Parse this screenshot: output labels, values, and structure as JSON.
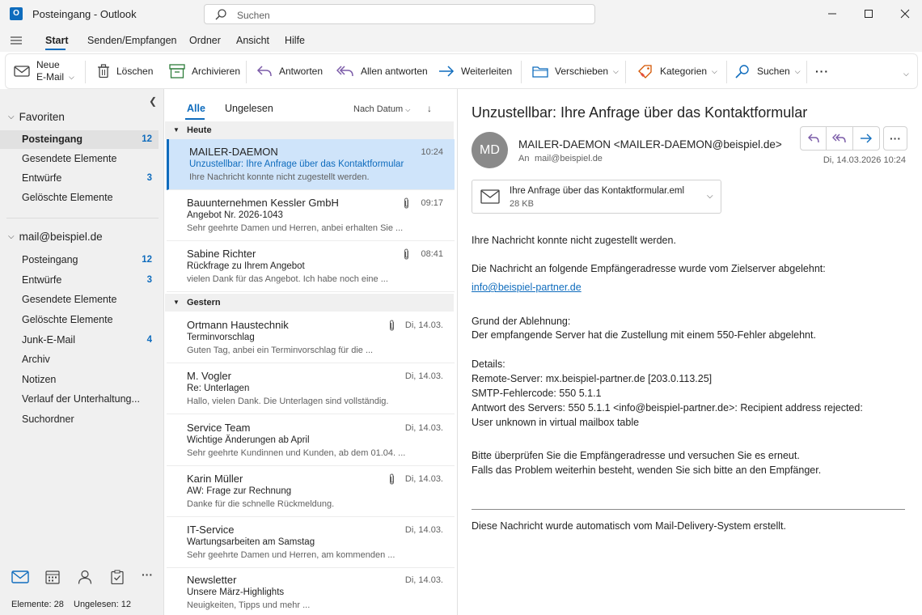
{
  "window": {
    "title": "Posteingang - Outlook",
    "search_placeholder": "Suchen",
    "app_letter": "O"
  },
  "menu": {
    "items": [
      "Start",
      "Senden/Empfangen",
      "Ordner",
      "Ansicht",
      "Hilfe"
    ],
    "active": "Start"
  },
  "ribbon": {
    "new_mail_line1": "Neue",
    "new_mail_line2": "E-Mail",
    "delete": "Löschen",
    "archive": "Archivieren",
    "reply": "Antworten",
    "reply_all": "Allen antworten",
    "forward": "Weiterleiten",
    "move": "Verschieben",
    "categorize": "Kategorien",
    "find": "Suchen",
    "more": "···"
  },
  "nav": {
    "favorites_label": "Favoriten",
    "favorites": [
      {
        "label": "Posteingang",
        "count": "12",
        "selected": true
      },
      {
        "label": "Gesendete Elemente",
        "count": ""
      },
      {
        "label": "Entwürfe",
        "count": "3"
      },
      {
        "label": "Gelöschte Elemente",
        "count": ""
      }
    ],
    "account_label": "mail@beispiel.de",
    "account": [
      {
        "label": "Posteingang",
        "count": "12"
      },
      {
        "label": "Entwürfe",
        "count": "3"
      },
      {
        "label": "Gesendete Elemente",
        "count": ""
      },
      {
        "label": "Gelöschte Elemente",
        "count": ""
      },
      {
        "label": "Junk-E-Mail",
        "count": "4"
      },
      {
        "label": "Archiv",
        "count": ""
      },
      {
        "label": "Notizen",
        "count": ""
      },
      {
        "label": "Verlauf der Unterhaltung...",
        "count": ""
      },
      {
        "label": "Suchordner",
        "count": ""
      }
    ]
  },
  "status": {
    "items": "Elemente: 28",
    "unread": "Ungelesen: 12"
  },
  "list": {
    "tab_all": "Alle",
    "tab_unread": "Ungelesen",
    "sort": "Nach Datum",
    "group_today": "Heute",
    "group_yesterday": "Gestern",
    "today": [
      {
        "sender": "MAILER-DAEMON",
        "subject": "Unzustellbar: Ihre Anfrage über das Kontaktformular",
        "preview": "Ihre Nachricht konnte nicht zugestellt werden.",
        "time": "10:24",
        "attachment": false,
        "selected": true
      },
      {
        "sender": "Bauunternehmen Kessler GmbH",
        "subject": "Angebot Nr. 2026-1043",
        "preview": "Sehr geehrte Damen und Herren, anbei erhalten Sie ...",
        "time": "09:17",
        "attachment": true
      },
      {
        "sender": "Sabine Richter",
        "subject": "Rückfrage zu Ihrem Angebot",
        "preview": "vielen Dank für das Angebot. Ich habe noch eine ...",
        "time": "08:41",
        "attachment": true
      }
    ],
    "yesterday": [
      {
        "sender": "Ortmann Haustechnik",
        "subject": "Terminvorschlag",
        "preview": "Guten Tag, anbei ein Terminvorschlag für die ...",
        "time": "Di, 14.03.",
        "attachment": true
      },
      {
        "sender": "M. Vogler",
        "subject": "Re: Unterlagen",
        "preview": "Hallo, vielen Dank. Die Unterlagen sind vollständig.",
        "time": "Di, 14.03.",
        "attachment": false
      },
      {
        "sender": "Service Team",
        "subject": "Wichtige Änderungen ab April",
        "preview": "Sehr geehrte Kundinnen und Kunden, ab dem 01.04. ...",
        "time": "Di, 14.03.",
        "attachment": false
      },
      {
        "sender": "Karin Müller",
        "subject": "AW: Frage zur Rechnung",
        "preview": "Danke für die schnelle Rückmeldung.",
        "time": "Di, 14.03.",
        "attachment": true
      },
      {
        "sender": "IT-Service",
        "subject": "Wartungsarbeiten am Samstag",
        "preview": "Sehr geehrte Damen und Herren, am kommenden ...",
        "time": "Di, 14.03.",
        "attachment": false
      },
      {
        "sender": "Newsletter",
        "subject": "Unsere März-Highlights",
        "preview": "Neuigkeiten, Tipps und mehr ...",
        "time": "Di, 14.03.",
        "attachment": false
      }
    ]
  },
  "reader": {
    "subject": "Unzustellbar: Ihre Anfrage über das Kontaktformular",
    "avatar_initials": "MD",
    "from": "MAILER-DAEMON <MAILER-DAEMON@beispiel.de>",
    "to_label": "An",
    "to": "mail@beispiel.de",
    "date": "Di, 14.03.2026 10:24",
    "attachment_name": "Ihre Anfrage über das Kontaktformular.eml",
    "attachment_size": "28 KB",
    "body": {
      "p1": "Ihre Nachricht konnte nicht zugestellt werden.",
      "p2": "Die Nachricht an folgende Empfängeradresse wurde vom Zielserver abgelehnt:",
      "link": "info@beispiel-partner.de",
      "reason_head": "Grund der Ablehnung:",
      "reason": "Der empfangende Server hat die Zustellung mit einem 550-Fehler abgelehnt.",
      "details_head": "Details:",
      "d1": "Remote-Server: mx.beispiel-partner.de [203.0.113.25]",
      "d2": "SMTP-Fehlercode: 550 5.1.1",
      "d3": "Antwort des Servers: 550 5.1.1 <info@beispiel-partner.de>: Recipient address rejected:",
      "d4": "User unknown in virtual mailbox table",
      "c1": "Bitte überprüfen Sie die Empfängeradresse und versuchen Sie es erneut.",
      "c2": "Falls das Problem weiterhin besteht, wenden Sie sich bitte an den Empfänger.",
      "footer": "Diese Nachricht wurde automatisch vom Mail-Delivery-System erstellt."
    }
  },
  "colors": {
    "accent": "#0f6cbd",
    "selected_row": "#cfe4fa",
    "nav_bg": "#f0f0f0"
  }
}
